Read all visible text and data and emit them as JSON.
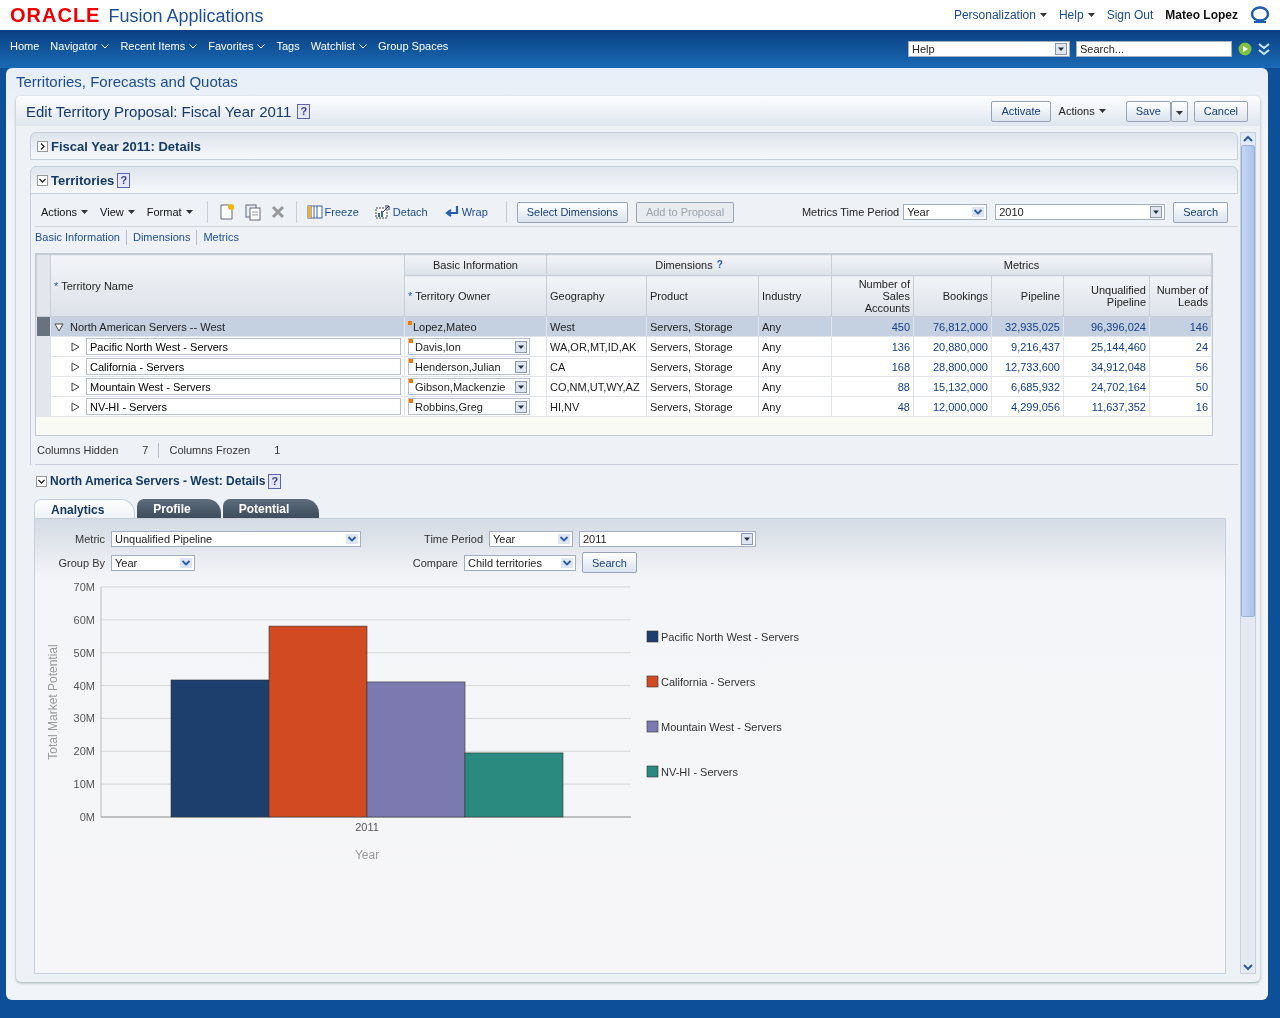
{
  "header": {
    "logo": "ORACLE",
    "app_name": "Fusion Applications",
    "links": [
      {
        "label": "Personalization",
        "menu": true
      },
      {
        "label": "Help",
        "menu": true
      },
      {
        "label": "Sign Out",
        "menu": false
      }
    ],
    "user": "Mateo Lopez"
  },
  "nav": {
    "items": [
      {
        "label": "Home",
        "menu": false
      },
      {
        "label": "Navigator",
        "menu": true
      },
      {
        "label": "Recent Items",
        "menu": true
      },
      {
        "label": "Favorites",
        "menu": true
      },
      {
        "label": "Tags",
        "menu": false
      },
      {
        "label": "Watchlist",
        "menu": true
      },
      {
        "label": "Group Spaces",
        "menu": false
      }
    ],
    "help_select": "Help",
    "search": {
      "placeholder": "Search..."
    }
  },
  "page_title": "Territories, Forecasts and Quotas",
  "proposal": {
    "title": "Edit Territory Proposal: Fiscal Year 2011",
    "help_icon": "?",
    "buttons": [
      {
        "label": "Activate",
        "kind": "button"
      },
      {
        "label": "Actions",
        "kind": "menu"
      },
      {
        "label": "Save",
        "kind": "split"
      },
      {
        "label": "Cancel",
        "kind": "button"
      }
    ]
  },
  "details_section": {
    "title": "Fiscal Year 2011: Details",
    "expanded": false
  },
  "territories": {
    "title": "Territories",
    "help_icon": "?",
    "expanded": true,
    "menus": [
      "Actions",
      "View",
      "Format"
    ],
    "tools": [
      {
        "label": "Freeze",
        "kind": "freeze"
      },
      {
        "label": "Detach",
        "kind": "detach"
      },
      {
        "label": "Wrap",
        "kind": "wrap"
      }
    ],
    "buttons": [
      {
        "label": "Select Dimensions",
        "disabled": false
      },
      {
        "label": "Add to Proposal",
        "disabled": true
      }
    ],
    "time_period_label": "Metrics Time Period",
    "time_period": "Year",
    "year": "2010",
    "search_button": "Search",
    "column_links": [
      "Basic Information",
      "Dimensions",
      "Metrics"
    ],
    "table": {
      "groups": [
        "Basic Information",
        "Dimensions",
        "Metrics"
      ],
      "dimensions_help": "?",
      "required_mark": "*",
      "columns": [
        "Territory Name",
        "Territory Owner",
        "Geography",
        "Product",
        "Industry",
        "Number of Sales Accounts",
        "Bookings",
        "Pipeline",
        "Unqualified Pipeline",
        "Number of Leads"
      ],
      "rows": [
        {
          "name": "North American Servers -- West",
          "owner": "Lopez,Mateo",
          "geography": "West",
          "product": "Servers, Storage",
          "industry": "Any",
          "metrics": [
            "450",
            "76,812,000",
            "32,935,025",
            "96,396,024",
            "146"
          ],
          "selected": true,
          "expanded": true,
          "editable": false,
          "children": [
            {
              "name": "Pacific North West - Servers",
              "owner": "Davis,Ion",
              "geography": "WA,OR,MT,ID,AK",
              "product": "Servers, Storage",
              "industry": "Any",
              "metrics": [
                "136",
                "20,880,000",
                "9,216,437",
                "25,144,460",
                "24"
              ],
              "selected": false,
              "expanded": false,
              "editable": true
            },
            {
              "name": "California - Servers",
              "owner": "Henderson,Julian",
              "geography": "CA",
              "product": "Servers, Storage",
              "industry": "Any",
              "metrics": [
                "168",
                "28,800,000",
                "12,733,600",
                "34,912,048",
                "56"
              ],
              "selected": false,
              "expanded": false,
              "editable": true
            },
            {
              "name": "Mountain West - Servers",
              "owner": "Gibson,Mackenzie",
              "geography": "CO,NM,UT,WY,AZ",
              "product": "Servers, Storage",
              "industry": "Any",
              "metrics": [
                "88",
                "15,132,000",
                "6,685,932",
                "24,702,164",
                "50"
              ],
              "selected": false,
              "expanded": false,
              "editable": true
            },
            {
              "name": "NV-HI - Servers",
              "owner": "Robbins,Greg",
              "geography": "HI,NV",
              "product": "Servers, Storage",
              "industry": "Any",
              "metrics": [
                "48",
                "12,000,000",
                "4,299,056",
                "11,637,352",
                "16"
              ],
              "selected": false,
              "expanded": false,
              "editable": true
            }
          ]
        }
      ]
    },
    "status": [
      {
        "label": "Columns Hidden",
        "value": "7"
      },
      {
        "label": "Columns Frozen",
        "value": "1"
      }
    ]
  },
  "detail": {
    "title": "North America Servers - West: Details",
    "help_icon": "?",
    "expanded": true,
    "tabs": [
      {
        "label": "Analytics",
        "selected": true
      },
      {
        "label": "Profile",
        "selected": false
      },
      {
        "label": "Potential",
        "selected": false
      }
    ],
    "metric": {
      "label": "Metric",
      "value": "Unqualified Pipeline"
    },
    "group_by": {
      "label": "Group By",
      "value": "Year"
    },
    "time_period": {
      "label": "Time Period",
      "value": "Year",
      "year": "2011"
    },
    "compare": {
      "label": "Compare",
      "value": "Child territories"
    },
    "search_button": "Search",
    "chart_data": {
      "type": "bar",
      "xlabel": "Year",
      "ylabel": "Total Market Potential",
      "categories": [
        "2011"
      ],
      "ylim": [
        0,
        70
      ],
      "grid": true,
      "legend": true,
      "yticks": [
        {
          "value": 0,
          "label": "0M"
        },
        {
          "value": 10,
          "label": "10M"
        },
        {
          "value": 20,
          "label": "20M"
        },
        {
          "value": 30,
          "label": "30M"
        },
        {
          "value": 40,
          "label": "40M"
        },
        {
          "value": 50,
          "label": "50M"
        },
        {
          "value": 60,
          "label": "60M"
        },
        {
          "value": 70,
          "label": "70M"
        }
      ],
      "series": [
        {
          "name": "Pacific North West - Servers",
          "color": "#1d3f6e",
          "values": [
            41.7
          ]
        },
        {
          "name": "California - Servers",
          "color": "#d24a22",
          "values": [
            58.1
          ]
        },
        {
          "name": "Mountain West - Servers",
          "color": "#7b79b0",
          "values": [
            41.1
          ]
        },
        {
          "name": "NV-HI - Servers",
          "color": "#2a8a80",
          "values": [
            19.5
          ]
        }
      ]
    }
  }
}
